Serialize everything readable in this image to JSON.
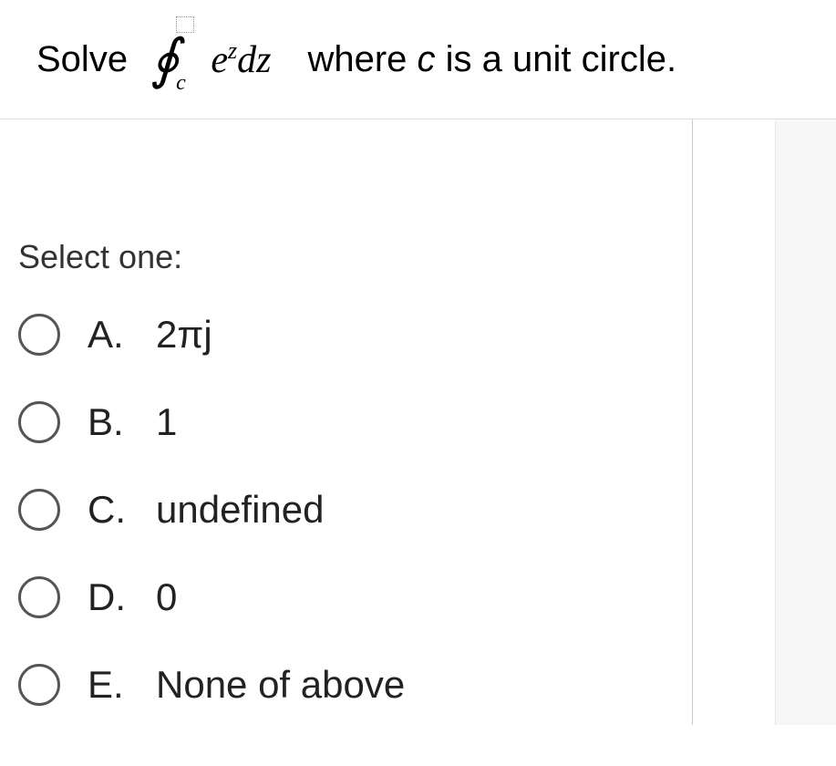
{
  "question": {
    "prefix": "Solve",
    "integral_subscript": "c",
    "integrand_base": "e",
    "integrand_exp": "z",
    "integrand_diff": "dz",
    "suffix_before_c": "where ",
    "suffix_c": "c",
    "suffix_after_c": " is a unit circle."
  },
  "prompt": "Select one:",
  "options": [
    {
      "letter": "A.",
      "value": "2πj"
    },
    {
      "letter": "B.",
      "value": "1"
    },
    {
      "letter": "C.",
      "value": "undefined"
    },
    {
      "letter": "D.",
      "value": "0"
    },
    {
      "letter": "E.",
      "value": "None of above"
    }
  ]
}
